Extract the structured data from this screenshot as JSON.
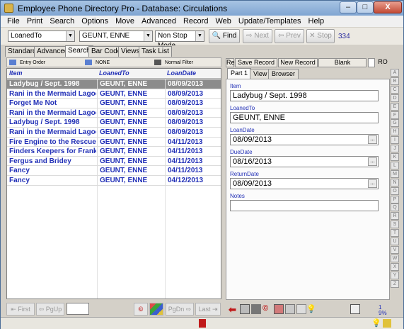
{
  "window": {
    "title": "Employee Phone Directory Pro - Database: Circulations",
    "min_label": "–",
    "max_label": "□",
    "close_label": "X"
  },
  "menu": [
    "File",
    "Print",
    "Search",
    "Options",
    "Move",
    "Advanced",
    "Record",
    "Web",
    "Update/Templates",
    "Help"
  ],
  "toolbar": {
    "field_select": "LoanedTo",
    "search_value": "GEUNT, ENNE",
    "mode_select": "Non Stop Mode",
    "find_label": "Find",
    "next_label": "Next",
    "prev_label": "Prev",
    "stop_label": "Stop",
    "count": "334"
  },
  "tabs": [
    "Standard",
    "Advanced",
    "Search",
    "Bar Code",
    "Views",
    "Task List"
  ],
  "active_tab": "Search",
  "filterbar": {
    "order": "Entry Order",
    "filter_field": "NONE",
    "filter_type": "Normal Filter"
  },
  "grid": {
    "columns": [
      "Item",
      "LoanedTo",
      "LoanDate"
    ],
    "rows": [
      [
        "Ladybug / Sept. 1998",
        "GEUNT, ENNE",
        "08/09/2013"
      ],
      [
        "Rani in the Mermaid Lagoon",
        "GEUNT, ENNE",
        "08/09/2013"
      ],
      [
        " Forget Me Not",
        "GEUNT, ENNE",
        "08/09/2013"
      ],
      [
        "Rani in the Mermaid Lagoon",
        "GEUNT, ENNE",
        "08/09/2013"
      ],
      [
        "Ladybug / Sept. 1998",
        "GEUNT, ENNE",
        "08/09/2013"
      ],
      [
        "Rani in the Mermaid Lagoon",
        "GEUNT, ENNE",
        "08/09/2013"
      ],
      [
        "Fire Engine to the Rescue",
        "GEUNT, ENNE",
        "04/11/2013"
      ],
      [
        "Finders Keepers for Franklin",
        "GEUNT, ENNE",
        "04/11/2013"
      ],
      [
        "Fergus and Bridey",
        "GEUNT, ENNE",
        "04/11/2013"
      ],
      [
        "Fancy",
        "GEUNT, ENNE",
        "04/11/2013"
      ],
      [
        "Fancy",
        "GEUNT, ENNE",
        "04/12/2013"
      ]
    ]
  },
  "bottomnav": {
    "first": "First",
    "pgup": "PgUp",
    "pgdn": "PgDn",
    "last": "Last"
  },
  "record": {
    "re_label": "Re",
    "save_label": "Save Record",
    "new_label": "New Record",
    "blank_label": "Blank",
    "ro_label": "RO",
    "tabs": [
      "Part 1",
      "View",
      "Browser"
    ],
    "fields": [
      {
        "label": "Item",
        "value": "Ladybug / Sept. 1998",
        "has_button": false
      },
      {
        "label": "LoanedTo",
        "value": "GEUNT, ENNE",
        "has_button": false
      },
      {
        "label": "LoanDate",
        "value": "08/09/2013",
        "has_button": true
      },
      {
        "label": "DueDate",
        "value": "08/16/2013",
        "has_button": true
      },
      {
        "label": "ReturnDate",
        "value": "08/09/2013",
        "has_button": true
      },
      {
        "label": "Notes",
        "value": "",
        "has_button": false
      }
    ]
  },
  "alphabet": [
    "A",
    "B",
    "C",
    "D",
    "E",
    "F",
    "G",
    "H",
    "I",
    "J",
    "K",
    "L",
    "M",
    "N",
    "O",
    "P",
    "Q",
    "R",
    "S",
    "T",
    "U",
    "V",
    "W",
    "X",
    "Y",
    "Z"
  ],
  "status": {
    "index": "1",
    "percent": "9%"
  }
}
